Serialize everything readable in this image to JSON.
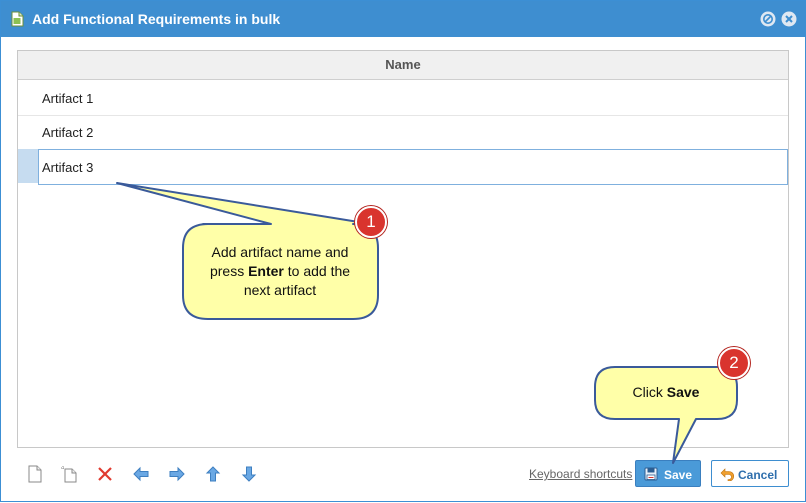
{
  "dialog": {
    "title": "Add Functional Requirements in bulk"
  },
  "grid": {
    "column_header": "Name",
    "rows": [
      {
        "name": "Artifact 1"
      },
      {
        "name": "Artifact 2"
      }
    ],
    "editing_value": "Artifact 3"
  },
  "callouts": {
    "step1": {
      "number": "1",
      "line1": "Add artifact name and",
      "line2_prefix": "press ",
      "line2_bold": "Enter",
      "line2_suffix": " to add the",
      "line3": "next artifact"
    },
    "step2": {
      "number": "2",
      "prefix": "Click ",
      "bold": "Save"
    }
  },
  "footer": {
    "keyboard_shortcuts": "Keyboard shortcuts",
    "save_label": "Save",
    "cancel_label": "Cancel"
  },
  "icons": {
    "title": "document-icon",
    "minimize": "minimize-icon",
    "close": "close-icon",
    "toolbar": [
      "new-row-icon",
      "insert-row-icon",
      "delete-icon",
      "outdent-icon",
      "indent-icon",
      "move-up-icon",
      "move-down-icon"
    ],
    "save": "floppy-disk-icon",
    "cancel": "undo-arrow-icon"
  },
  "colors": {
    "titlebar": "#3e8ed0",
    "callout_fill": "#ffffa8",
    "callout_stroke": "#3a5a9a",
    "badge": "#d9342e",
    "save_button": "#4a9ad8"
  }
}
